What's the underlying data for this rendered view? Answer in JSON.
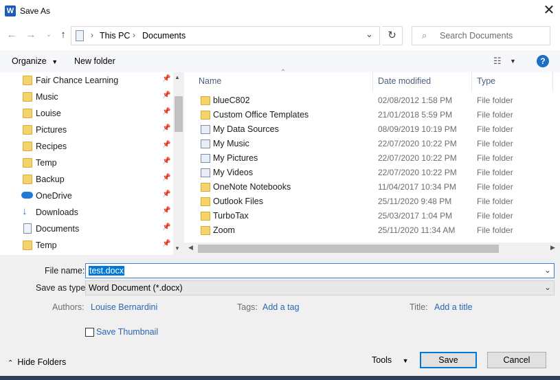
{
  "window": {
    "title": "Save As",
    "app_icon_letter": "W"
  },
  "nav": {
    "breadcrumb": [
      "This PC",
      "Documents"
    ],
    "search_placeholder": "Search Documents"
  },
  "toolbar": {
    "organize_label": "Organize",
    "new_folder_label": "New folder"
  },
  "sidebar": {
    "items": [
      {
        "label": "Fair Chance Learning",
        "icon": "folder-icon",
        "pinned": true
      },
      {
        "label": "Music",
        "icon": "folder-icon",
        "pinned": true
      },
      {
        "label": "Louise",
        "icon": "folder-icon",
        "pinned": true
      },
      {
        "label": "Pictures",
        "icon": "folder-icon",
        "pinned": true
      },
      {
        "label": "Recipes",
        "icon": "folder-icon",
        "pinned": true
      },
      {
        "label": "Temp",
        "icon": "folder-icon",
        "pinned": true
      },
      {
        "label": "Backup",
        "icon": "folder-icon",
        "pinned": true
      },
      {
        "label": "OneDrive",
        "icon": "cloud-icon",
        "pinned": true
      },
      {
        "label": "Downloads",
        "icon": "download-icon",
        "pinned": true
      },
      {
        "label": "Documents",
        "icon": "documents-icon",
        "pinned": true
      },
      {
        "label": "Temp",
        "icon": "folder-icon",
        "pinned": true
      }
    ]
  },
  "filelist": {
    "columns": {
      "name": "Name",
      "date": "Date modified",
      "type": "Type"
    },
    "rows": [
      {
        "name": "blueC802",
        "date": "02/08/2012 1:58 PM",
        "type": "File folder"
      },
      {
        "name": "Custom Office Templates",
        "date": "21/01/2018 5:59 PM",
        "type": "File folder"
      },
      {
        "name": "My Data Sources",
        "date": "08/09/2019 10:19 PM",
        "type": "File folder"
      },
      {
        "name": "My Music",
        "date": "22/07/2020 10:22 PM",
        "type": "File folder"
      },
      {
        "name": "My Pictures",
        "date": "22/07/2020 10:22 PM",
        "type": "File folder"
      },
      {
        "name": "My Videos",
        "date": "22/07/2020 10:22 PM",
        "type": "File folder"
      },
      {
        "name": "OneNote Notebooks",
        "date": "11/04/2017 10:34 PM",
        "type": "File folder"
      },
      {
        "name": "Outlook Files",
        "date": "25/11/2020 9:48 PM",
        "type": "File folder"
      },
      {
        "name": "TurboTax",
        "date": "25/03/2017 1:04 PM",
        "type": "File folder"
      },
      {
        "name": "Zoom",
        "date": "25/11/2020 11:34 AM",
        "type": "File folder"
      }
    ]
  },
  "form": {
    "filename_label": "File name:",
    "filename_value": "test.docx",
    "savetype_label": "Save as type:",
    "savetype_value": "Word Document (*.docx)",
    "authors_label": "Authors:",
    "authors_value": "Louise Bernardini",
    "tags_label": "Tags:",
    "tags_value": "Add a tag",
    "title_label": "Title:",
    "title_value": "Add a title",
    "thumbnail_label": "Save Thumbnail"
  },
  "footer": {
    "hide_folders_label": "Hide Folders",
    "tools_label": "Tools",
    "save_label": "Save",
    "cancel_label": "Cancel"
  },
  "colors": {
    "accent": "#0078d7",
    "link": "#2a66b3",
    "help": "#1f6fc5"
  }
}
